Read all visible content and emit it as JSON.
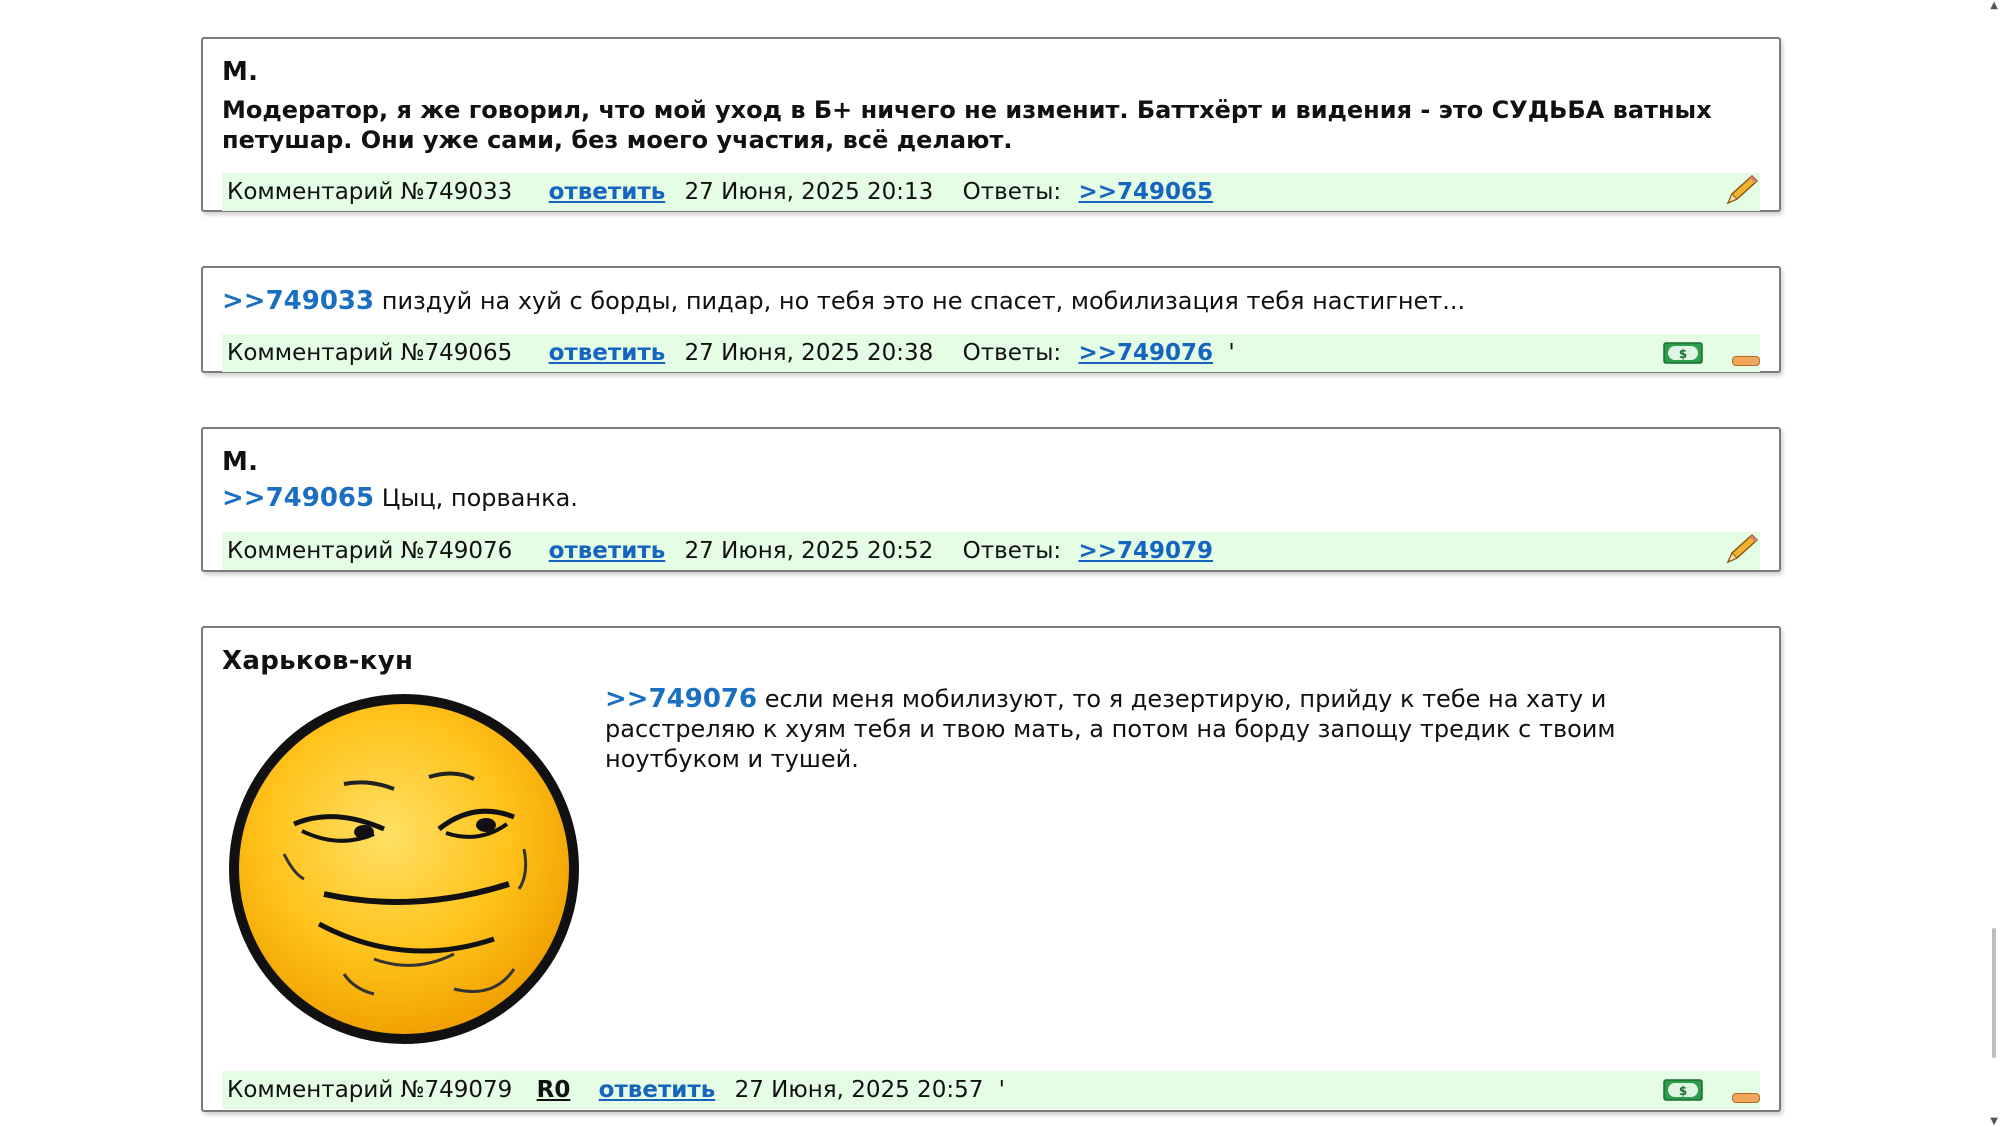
{
  "posts": [
    {
      "author": "М.",
      "text": "Модератор, я же говорил, что мой уход в Б+ ничего не изменит. Баттхёрт и видения - это СУДЬБА ватных петушар. Они уже сами, без моего участия, всё делают.",
      "number": "Комментарий №749033",
      "reply": "ответить",
      "date": "27 Июня, 2025 20:13",
      "answers_label": "Ответы:",
      "answers": ">>749065"
    },
    {
      "ref": ">>749033",
      "text": " пиздуй на хуй с борды, пидар, но тебя это не спасет, мобилизация тебя настигнет...",
      "number": "Комментарий №749065",
      "reply": "ответить",
      "date": "27 Июня, 2025 20:38",
      "answers_label": "Ответы:",
      "answers": ">>749076",
      "tail": "'"
    },
    {
      "author": "М.",
      "ref": ">>749065",
      "text": " Цыц, порванка.",
      "number": "Комментарий №749076",
      "reply": "ответить",
      "date": "27 Июня, 2025 20:52",
      "answers_label": "Ответы:",
      "answers": ">>749079"
    },
    {
      "author": "Харьков-кун",
      "ref": ">>749076",
      "text": " если меня мобилизуют, то я дезертирую, прийду к тебе на хату и расстреляю к хуям тебя и твою мать, а потом на борду запощу тредик с твоим ноутбуком и тушей.",
      "number": "Комментарий №749079",
      "rating": "R0",
      "reply": "ответить",
      "date": "27 Июня, 2025 20:57",
      "tail": "'"
    }
  ],
  "icons": {
    "edit": "pencil-icon",
    "donate": "money-icon",
    "downvote": "minus-icon",
    "avatar": "smiley-avatar"
  },
  "colors": {
    "footer_bg": "#e4fde4",
    "link": "#1565c0",
    "ref": "#1a6fc0",
    "border": "#7b7b7b"
  }
}
